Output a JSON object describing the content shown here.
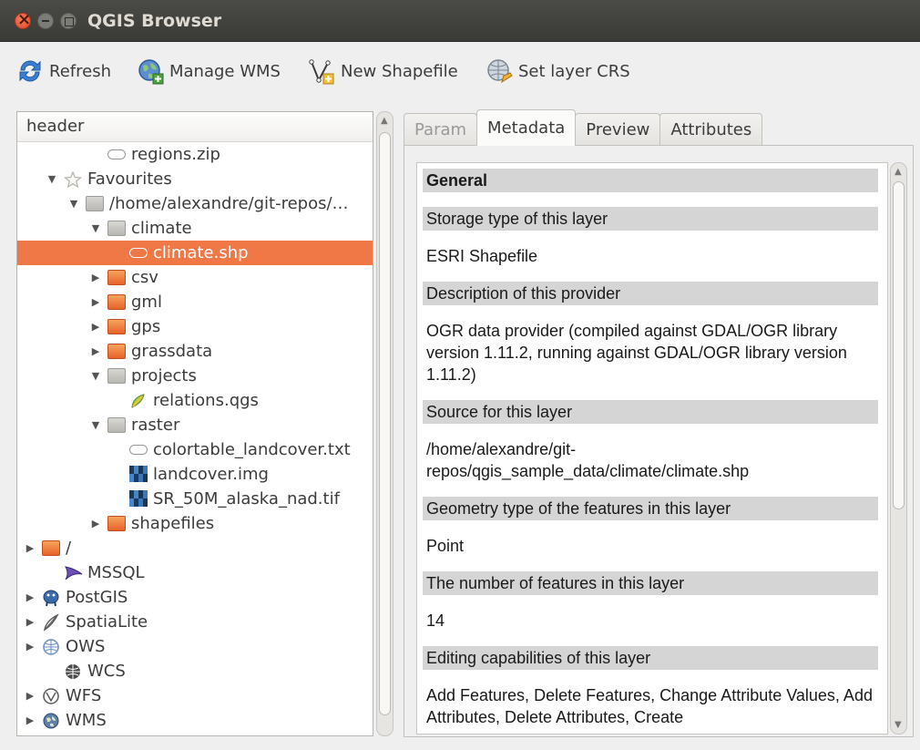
{
  "window": {
    "title": "QGIS Browser"
  },
  "toolbar": {
    "refresh": "Refresh",
    "manage_wms": "Manage WMS",
    "new_shapefile": "New Shapefile",
    "set_layer_crs": "Set layer CRS"
  },
  "tree": {
    "header": "header",
    "rows": [
      {
        "label": "regions.zip",
        "indent": 3,
        "icon": "zip-icon",
        "arrow": ""
      },
      {
        "label": "Favourites",
        "indent": 1,
        "icon": "star-icon",
        "arrow": "expanded"
      },
      {
        "label": "/home/alexandre/git-repos/…",
        "indent": 2,
        "icon": "folder-icon",
        "arrow": "expanded"
      },
      {
        "label": "climate",
        "indent": 3,
        "icon": "folder-icon",
        "arrow": "expanded"
      },
      {
        "label": "climate.shp",
        "indent": 4,
        "icon": "zip-icon",
        "arrow": "",
        "selected": true
      },
      {
        "label": "csv",
        "indent": 3,
        "icon": "orange-folder-icon",
        "arrow": "collapsed"
      },
      {
        "label": "gml",
        "indent": 3,
        "icon": "orange-folder-icon",
        "arrow": "collapsed"
      },
      {
        "label": "gps",
        "indent": 3,
        "icon": "orange-folder-icon",
        "arrow": "collapsed"
      },
      {
        "label": "grassdata",
        "indent": 3,
        "icon": "orange-folder-icon",
        "arrow": "collapsed"
      },
      {
        "label": "projects",
        "indent": 3,
        "icon": "folder-icon",
        "arrow": "expanded"
      },
      {
        "label": "relations.qgs",
        "indent": 4,
        "icon": "qgis-project-icon",
        "arrow": ""
      },
      {
        "label": "raster",
        "indent": 3,
        "icon": "folder-icon",
        "arrow": "expanded"
      },
      {
        "label": "colortable_landcover.txt",
        "indent": 4,
        "icon": "zip-icon",
        "arrow": ""
      },
      {
        "label": "landcover.img",
        "indent": 4,
        "icon": "raster-icon",
        "arrow": ""
      },
      {
        "label": "SR_50M_alaska_nad.tif",
        "indent": 4,
        "icon": "raster-icon",
        "arrow": ""
      },
      {
        "label": "shapefiles",
        "indent": 3,
        "icon": "orange-folder-icon",
        "arrow": "collapsed"
      },
      {
        "label": "/",
        "indent": 0,
        "icon": "orange-folder-icon",
        "arrow": "collapsed"
      },
      {
        "label": "MSSQL",
        "indent": 1,
        "icon": "mssql-icon",
        "arrow": ""
      },
      {
        "label": "PostGIS",
        "indent": 0,
        "icon": "postgis-icon",
        "arrow": "collapsed"
      },
      {
        "label": "SpatiaLite",
        "indent": 0,
        "icon": "spatialite-icon",
        "arrow": "collapsed"
      },
      {
        "label": "OWS",
        "indent": 0,
        "icon": "ows-icon",
        "arrow": "collapsed"
      },
      {
        "label": "WCS",
        "indent": 1,
        "icon": "wcs-icon",
        "arrow": ""
      },
      {
        "label": "WFS",
        "indent": 0,
        "icon": "wfs-icon",
        "arrow": "collapsed"
      },
      {
        "label": "WMS",
        "indent": 0,
        "icon": "wms-icon",
        "arrow": "collapsed"
      }
    ]
  },
  "tabs": {
    "param": "Param",
    "metadata": "Metadata",
    "preview": "Preview",
    "attributes": "Attributes"
  },
  "metadata": {
    "general": "General",
    "storage_type_label": "Storage type of this layer",
    "storage_type_value": "ESRI Shapefile",
    "provider_desc_label": "Description of this provider",
    "provider_desc_value": "OGR data provider (compiled against GDAL/OGR library version 1.11.2, running against GDAL/OGR library version 1.11.2)",
    "source_label": "Source for this layer",
    "source_value_1": "/home/alexandre/git-",
    "source_value_2": "repos/qgis_sample_data/climate/climate.shp",
    "geometry_label": "Geometry type of the features in this layer",
    "geometry_value": "Point",
    "feature_count_label": "The number of features in this layer",
    "feature_count_value": "14",
    "editing_label": "Editing capabilities of this layer",
    "editing_value": "Add Features, Delete Features, Change Attribute Values, Add Attributes, Delete Attributes, Create"
  }
}
